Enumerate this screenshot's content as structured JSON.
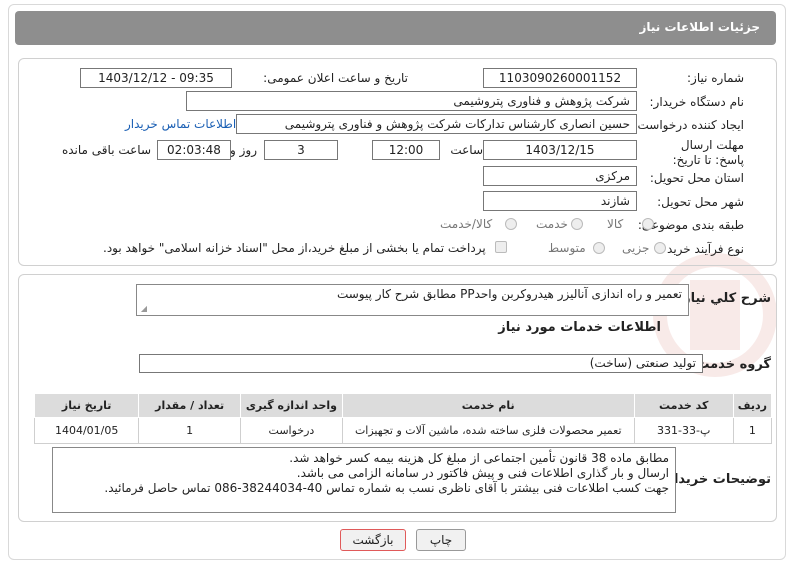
{
  "header": {
    "title": "جزئیات اطلاعات نیاز"
  },
  "form": {
    "need_number_label": "شماره نیاز:",
    "need_number": "1103090260001152",
    "announce_label": "تاریخ و ساعت اعلان عمومی:",
    "announce_value": "1403/12/12 - 09:35",
    "buyer_org_label": "نام دستگاه خریدار:",
    "buyer_org": "شرکت پژوهش و فناوری پتروشیمی",
    "requester_label": "ایجاد کننده درخواست:",
    "requester": "حسین انصاری کارشناس تدارکات شرکت پژوهش و فناوری پتروشیمی",
    "contact_link": "اطلاعات تماس خریدار",
    "deadline_label": "مهلت ارسال پاسخ: تا تاریخ:",
    "deadline_date": "1403/12/15",
    "time_label": "ساعت",
    "deadline_time": "12:00",
    "days_value": "3",
    "days_label": "روز و",
    "remaining_time": "02:03:48",
    "remaining_label": "ساعت باقی مانده",
    "province_label": "استان محل تحویل:",
    "province": "مرکزی",
    "city_label": "شهر محل تحویل:",
    "city": "شازند",
    "category_label": "طبقه بندی موضوعی:",
    "category_options": [
      "کالا",
      "خدمت",
      "کالا/خدمت"
    ],
    "process_label": "نوع فرآیند خرید :",
    "process_options": [
      "جزیی",
      "متوسط"
    ],
    "payment_note": "پرداخت تمام یا بخشی از مبلغ خرید،از محل \"اسناد خزانه اسلامی\" خواهد بود."
  },
  "details": {
    "summary_label": "شرح كلي نياز:",
    "summary": "تعمیر و راه اندازی آنالیزر هیدروکربن واحدPP مطابق شرح کار پیوست",
    "services_title": "اطلاعات خدمات مورد نیاز",
    "service_group_label": "گروه خدمت:",
    "service_group": "تولید صنعتی (ساخت)",
    "table": {
      "headers": [
        "ردیف",
        "کد خدمت",
        "نام خدمت",
        "واحد اندازه گیری",
        "تعداد / مقدار",
        "تاریخ نیاز"
      ],
      "rows": [
        [
          "1",
          "پ-33-331",
          "تعمیر محصولات فلزی ساخته شده، ماشین آلات و تجهیزات",
          "درخواست",
          "1",
          "1404/01/05"
        ]
      ]
    },
    "buyer_notes_label": "توضیحات خریدار:",
    "buyer_notes": [
      "مطابق ماده 38 قانون تأمین اجتماعی از مبلغ کل هزینه بیمه کسر خواهد شد.",
      "ارسال و بار گذاری اطلاعات فنی و پیش فاکتور در سامانه الزامی می باشد.",
      "جهت کسب اطلاعات فنی بیشتر با آقای ناظری نسب به شماره تماس  40-38244034-086 تماس حاصل فرمائید."
    ]
  },
  "buttons": {
    "print": "چاپ",
    "back": "بازگشت"
  },
  "colors": {
    "header_bg": "#8e8e8e",
    "link": "#1a5fb4",
    "back_button_border": "#e05a5a"
  }
}
